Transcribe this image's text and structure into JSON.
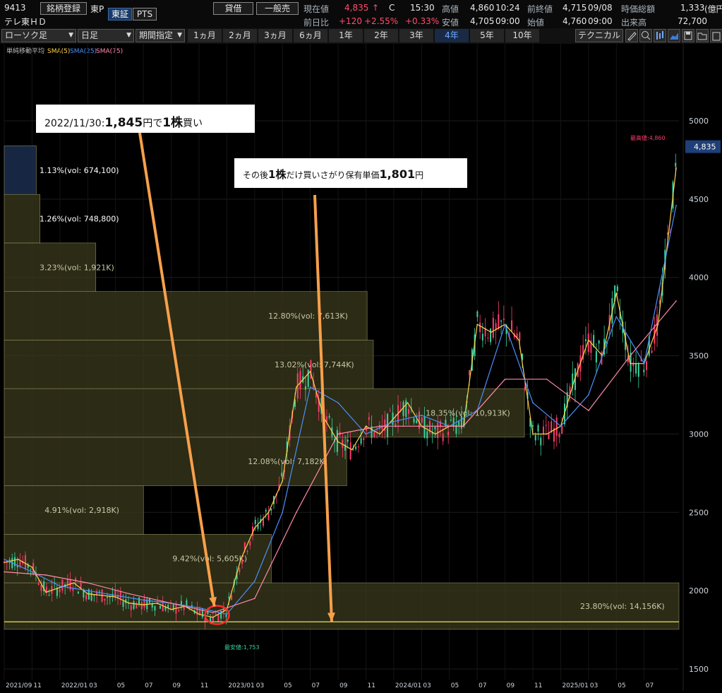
{
  "header": {
    "code": "9413",
    "register_btn": "銘柄登録",
    "market_short": "東P",
    "tab_tse": "東証",
    "tab_pts": "PTS",
    "name": "テレ東ＨＤ",
    "btn_lending": "貸借",
    "btn_general": "一般売",
    "current_label": "現在値",
    "current_value": "4,835",
    "current_arrow": "↑",
    "current_flag": "C",
    "current_time": "15:30",
    "high_label": "高値",
    "high_value": "4,860",
    "high_time": "10:24",
    "prev_close_label": "前終値",
    "prev_close_value": "4,715",
    "prev_close_date": "09/08",
    "mcap_label": "時価総額",
    "mcap_value": "1,333",
    "mcap_unit": "(億円",
    "change_label": "前日比",
    "change_value": "+120",
    "change_pct": "+2.55%",
    "change_pct2": "+0.33%",
    "low_label": "安値",
    "low_value": "4,705",
    "low_time": "09:00",
    "open_label": "始値",
    "open_value": "4,760",
    "open_time": "09:00",
    "volume_label": "出来高",
    "volume_value": "72,700"
  },
  "toolbar": {
    "chart_type": "ローソク足",
    "interval": "日足",
    "range_mode": "期間指定",
    "periods": [
      "1ヵ月",
      "2ヵ月",
      "3ヵ月",
      "6ヵ月",
      "1年",
      "2年",
      "3年",
      "4年",
      "5年",
      "10年"
    ],
    "active_period": "4年",
    "technical": "テクニカル"
  },
  "colors": {
    "sma5": "#ffd24a",
    "sma25": "#4a90ff",
    "sma75": "#ff8aa8",
    "up": "#ff3b6b",
    "down": "#3ad29f",
    "volbox": "#3b3a1c",
    "volbox_top": "#1a2a4a",
    "arrow": "#f7a04a"
  },
  "chart_data": {
    "type": "line",
    "indicator_legend": {
      "title": "単純移動平均",
      "items": [
        "SMA(5)",
        "SMA(25)",
        "SMA(75)"
      ]
    },
    "y_ticks": [
      1500,
      2000,
      2500,
      3000,
      3500,
      4000,
      4500,
      5000
    ],
    "ylim": [
      1450,
      5350
    ],
    "x_ticks": [
      "2021/09",
      "11",
      "2022/01",
      "03",
      "05",
      "07",
      "09",
      "11",
      "2023/01",
      "03",
      "05",
      "07",
      "09",
      "11",
      "2024/01",
      "03",
      "05",
      "07",
      "09",
      "11",
      "2025/01",
      "03",
      "05",
      "07"
    ],
    "x_tick_pos": [
      0,
      2,
      4,
      6,
      8,
      10,
      12,
      14,
      16,
      18,
      20,
      22,
      24,
      26,
      28,
      30,
      32,
      34,
      36,
      38,
      40,
      42,
      44,
      46
    ],
    "xlim": [
      0,
      48.5
    ],
    "series": [
      {
        "name": "SMA(5)",
        "x": [
          0,
          1,
          2,
          3,
          4,
          5,
          6,
          7,
          8,
          9,
          10,
          11,
          12,
          13,
          14,
          15,
          16,
          17,
          18,
          19,
          20,
          21,
          22,
          23,
          24,
          25,
          26,
          27,
          28,
          29,
          30,
          31,
          32,
          33,
          34,
          35,
          36,
          37,
          38,
          39,
          40,
          41,
          42,
          43,
          44,
          45,
          46,
          47,
          48.3
        ],
        "values": [
          2180,
          2200,
          2150,
          1990,
          2020,
          2050,
          1980,
          1970,
          1960,
          1920,
          1910,
          1920,
          1880,
          1900,
          1850,
          1830,
          1880,
          2200,
          2400,
          2500,
          2700,
          3300,
          3400,
          3100,
          2950,
          2900,
          3050,
          3000,
          3100,
          3200,
          3050,
          3000,
          3050,
          3050,
          3700,
          3650,
          3700,
          3600,
          3000,
          3000,
          3050,
          3350,
          3600,
          3500,
          3900,
          3450,
          3450,
          3700,
          4700
        ]
      },
      {
        "name": "SMA(25)",
        "x": [
          0,
          2,
          4,
          6,
          8,
          10,
          12,
          14,
          16,
          18,
          20,
          22,
          24,
          26,
          28,
          30,
          32,
          34,
          36,
          38,
          40,
          42,
          44,
          46,
          48.3
        ],
        "values": [
          2200,
          2120,
          2030,
          2000,
          1970,
          1940,
          1920,
          1890,
          1850,
          2060,
          2500,
          3300,
          3200,
          3000,
          3080,
          3120,
          3050,
          3150,
          3700,
          3200,
          3050,
          3250,
          3750,
          3450,
          4460
        ]
      },
      {
        "name": "SMA(75)",
        "x": [
          0,
          3,
          6,
          9,
          12,
          15,
          18,
          21,
          24,
          27,
          30,
          33,
          36,
          39,
          42,
          45,
          48.3
        ],
        "values": [
          2120,
          2100,
          2050,
          1980,
          1920,
          1860,
          1950,
          2500,
          3000,
          3050,
          3050,
          3050,
          3350,
          3350,
          3150,
          3500,
          3850
        ]
      }
    ],
    "volume_profile": [
      {
        "label": "23.80%(vol: 14,156K)",
        "low": 1753,
        "high": 2050,
        "pct": 23.8
      },
      {
        "label": "9.42%(vol: 5,605K)",
        "low": 2050,
        "high": 2360,
        "pct": 9.42
      },
      {
        "label": "4.91%(vol: 2,918K)",
        "low": 2360,
        "high": 2670,
        "pct": 4.91
      },
      {
        "label": "12.08%(vol: 7,182K)",
        "low": 2670,
        "high": 2980,
        "pct": 12.08
      },
      {
        "label": "18.35%(vol: 10,913K)",
        "low": 2980,
        "high": 3290,
        "pct": 18.35
      },
      {
        "label": "13.02%(vol: 7,744K)",
        "low": 3290,
        "high": 3600,
        "pct": 13.02
      },
      {
        "label": "12.80%(vol: 7,613K)",
        "low": 3600,
        "high": 3910,
        "pct": 12.8
      },
      {
        "label": "3.23%(vol: 1,921K)",
        "low": 3910,
        "high": 4220,
        "pct": 3.23
      },
      {
        "label": "1.26%(vol: 748,800)",
        "low": 4220,
        "high": 4530,
        "pct": 1.26
      },
      {
        "label": "1.13%(vol: 674,100)",
        "low": 4530,
        "high": 4840,
        "pct": 1.13
      }
    ],
    "annotations": {
      "high_label": "最高値:4,860",
      "high_value": 4860,
      "low_label": "最安値:1,753",
      "low_value": 1753,
      "current_price_label": "4,835",
      "current_price": 4835,
      "callout1_parts": [
        "2022/11/30:",
        "1,845",
        "円で",
        "1株",
        "買い"
      ],
      "callout2_parts": [
        "その後",
        "1株",
        "だけ買いさがり保有単価",
        "1,801",
        "円"
      ],
      "buy_price_line": 1801
    }
  }
}
